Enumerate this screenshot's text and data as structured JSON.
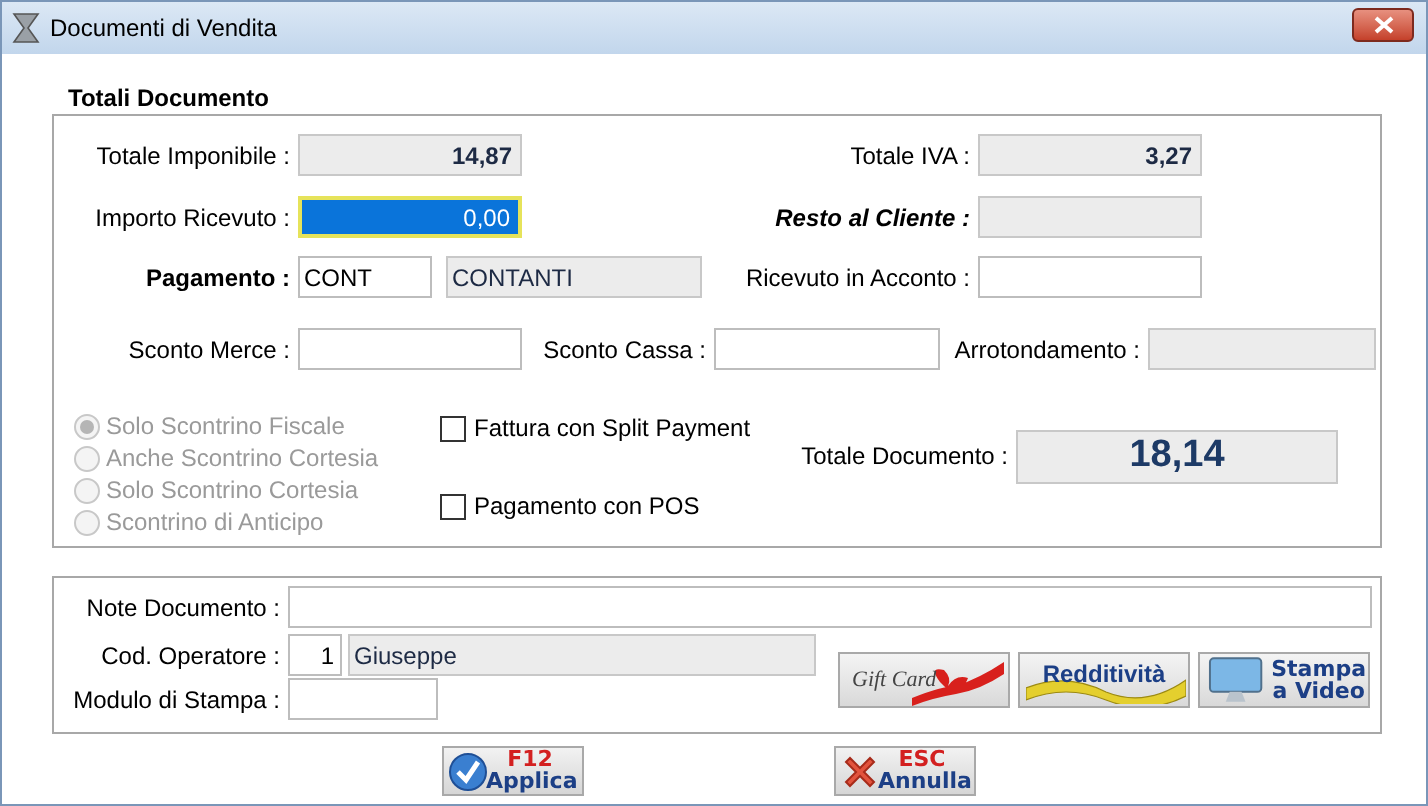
{
  "window": {
    "title": "Documenti di Vendita"
  },
  "totals": {
    "title": "Totali Documento",
    "imponibile": {
      "label": "Totale Imponibile :",
      "value": "14,87",
      "readonly": true
    },
    "iva": {
      "label": "Totale IVA :",
      "value": "3,27",
      "readonly": true
    },
    "importo": {
      "label": "Importo Ricevuto :",
      "value": "0,00",
      "focused": true
    },
    "resto": {
      "label": "Resto al Cliente :",
      "readonly": true
    },
    "pagamento": {
      "label": "Pagamento :",
      "code": "CONT",
      "name": "CONTANTI"
    },
    "acconto": {
      "label": "Ricevuto in Acconto :",
      "readonly": false
    },
    "sconto_merce": {
      "label": "Sconto Merce :",
      "readonly": false
    },
    "sconto_cassa": {
      "label": "Sconto Cassa :",
      "readonly": false
    },
    "arrotondamento": {
      "label": "Arrotondamento :",
      "readonly": true
    },
    "receipt_options": [
      {
        "label": "Solo Scontrino Fiscale",
        "selected": true,
        "disabled": true
      },
      {
        "label": "Anche Scontrino Cortesia",
        "selected": false,
        "disabled": true
      },
      {
        "label": "Solo Scontrino Cortesia",
        "selected": false,
        "disabled": true
      },
      {
        "label": "Scontrino di Anticipo",
        "selected": false,
        "disabled": true
      }
    ],
    "checkboxes": [
      {
        "label": "Fattura con Split Payment",
        "checked": false
      },
      {
        "label": "Pagamento con POS",
        "checked": false
      }
    ],
    "totale_documento": {
      "label": "Totale Documento :",
      "value": "18,14"
    }
  },
  "details": {
    "note": {
      "label": "Note Documento :"
    },
    "operatore": {
      "label": "Cod. Operatore :",
      "code": "1",
      "name": "Giuseppe"
    },
    "modulo": {
      "label": "Modulo di Stampa :"
    },
    "buttons": [
      {
        "kind": "giftcard",
        "label": "Gift Card"
      },
      {
        "kind": "profit",
        "label": "Redditività"
      },
      {
        "kind": "preview",
        "label": "Stampa a Video"
      }
    ]
  },
  "actions": [
    {
      "kind": "apply",
      "key": "F12",
      "label": "Applica"
    },
    {
      "kind": "cancel",
      "key": "ESC",
      "label": "Annulla"
    }
  ]
}
